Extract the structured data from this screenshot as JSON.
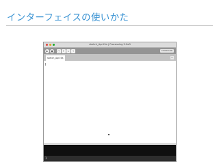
{
  "slide": {
    "title": "インターフェイスの使いかた"
  },
  "window": {
    "title": "sketch_Apr19a | Processing 2.0a3",
    "toolbar": {
      "buttons": [
        {
          "name": "run-button",
          "icon": "▶"
        },
        {
          "name": "stop-button",
          "icon": "■"
        },
        {
          "name": "new-button",
          "icon": "□"
        },
        {
          "name": "open-button",
          "icon": "↑"
        },
        {
          "name": "save-button",
          "icon": "↓"
        },
        {
          "name": "export-button",
          "icon": "→"
        }
      ],
      "mode_label": "STANDARD"
    },
    "tab": {
      "label": "sketch_Apr19a",
      "arrow_icon": "▸"
    },
    "status": {
      "line_number": "1"
    }
  }
}
